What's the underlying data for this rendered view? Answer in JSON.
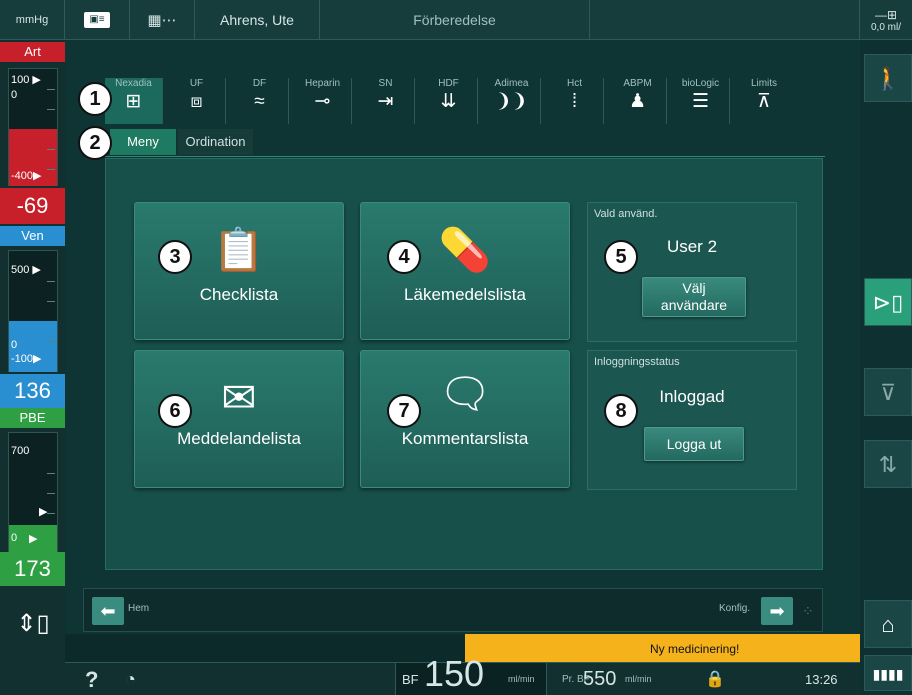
{
  "topbar": {
    "unit": "mmHg",
    "patient_name": "Ahrens, Ute",
    "phase": "Förberedelse",
    "right_value": "0,0",
    "right_unit": "ml/"
  },
  "left_panel": {
    "art": {
      "label": "Art",
      "top_limit": "100 ▶",
      "zero": "0",
      "bottom_limit": "-400▶",
      "value": "-69"
    },
    "ven": {
      "label": "Ven",
      "top_limit": "500 ▶",
      "zero": "0",
      "bottom_limit": "-100▶",
      "value": "136"
    },
    "pbe": {
      "label": "PBE",
      "top_limit": "700",
      "zero": "0",
      "value": "173"
    }
  },
  "tabs": [
    {
      "label": "Nexadia",
      "icon": "nexadia-icon",
      "glyph": "⊞"
    },
    {
      "label": "UF",
      "icon": "uf-icon",
      "glyph": "⧈"
    },
    {
      "label": "DF",
      "icon": "df-icon",
      "glyph": "≈"
    },
    {
      "label": "Heparin",
      "icon": "syringe-icon",
      "glyph": "⊸"
    },
    {
      "label": "SN",
      "icon": "sn-icon",
      "glyph": "⇥"
    },
    {
      "label": "HDF",
      "icon": "hdf-icon",
      "glyph": "⇊"
    },
    {
      "label": "Adimea",
      "icon": "adimea-icon",
      "glyph": "❩❩"
    },
    {
      "label": "Hct",
      "icon": "hct-icon",
      "glyph": "⁞"
    },
    {
      "label": "ABPM",
      "icon": "abpm-icon",
      "glyph": "♟"
    },
    {
      "label": "bioLogic",
      "icon": "biologic-icon",
      "glyph": "☰"
    },
    {
      "label": "Limits",
      "icon": "limits-icon",
      "glyph": "⊼"
    }
  ],
  "subtabs": {
    "meny": "Meny",
    "ordination": "Ordination"
  },
  "buttons": {
    "checklista": "Checklista",
    "lakemedelslista": "Läkemedelslista",
    "meddelandelista": "Meddelandelista",
    "kommentarslista": "Kommentarslista"
  },
  "user_panel": {
    "title": "Vald använd.",
    "user": "User 2",
    "select_line1": "Välj",
    "select_line2": "användare"
  },
  "login_panel": {
    "title": "Inloggningsstatus",
    "status": "Inloggad",
    "logout": "Logga ut"
  },
  "markers": [
    "1",
    "2",
    "3",
    "4",
    "5",
    "6",
    "7",
    "8"
  ],
  "navbar": {
    "home": "Hem",
    "config": "Konfig."
  },
  "alert": {
    "text": "Ny medicinering!"
  },
  "bottombar": {
    "help": "?",
    "bf_label": "BF",
    "bf_value": "150",
    "bf_unit": "ml/min",
    "prbf_label": "Pr. BF",
    "prbf_value": "550",
    "prbf_unit": "ml/min",
    "time": "13:26"
  },
  "colors": {
    "accent": "#1f7a62",
    "alert": "#f5b21b",
    "art": "#c8202a",
    "ven": "#2a8fd0",
    "pbe": "#2ea043"
  }
}
